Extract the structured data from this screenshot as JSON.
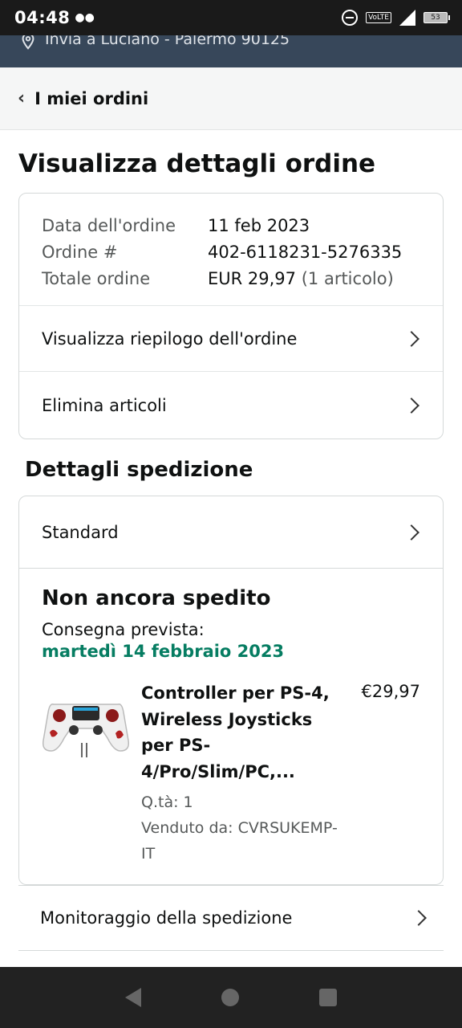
{
  "status_bar": {
    "time": "04:48",
    "battery": "53",
    "network": "VoLTE",
    "network_gen": "4G"
  },
  "deliver_to": "Invia a Luciano - Palermo 90125",
  "nav": {
    "back_label": "I miei ordini"
  },
  "page_title": "Visualizza dettagli ordine",
  "order_info": {
    "date_label": "Data dell'ordine",
    "date_value": "11 feb 2023",
    "number_label": "Ordine #",
    "number_value": "402-6118231-5276335",
    "total_label": "Totale ordine",
    "total_value": "EUR 29,97",
    "total_items": "(1 articolo)"
  },
  "order_links": {
    "summary": "Visualizza riepilogo dell'ordine",
    "delete_items": "Elimina articoli"
  },
  "shipping": {
    "section_title": "Dettagli spedizione",
    "method": "Standard",
    "status": "Non ancora spedito",
    "eta_label": "Consegna prevista:",
    "eta_date": "martedì 14 febbraio 2023",
    "eta_color": "#067d62"
  },
  "product": {
    "name": "Controller per PS-4, Wireless Joysticks per PS-4/Pro/Slim/PC,...",
    "qty": "Q.tà: 1",
    "seller": "Venduto da: CVRSUKEMP-IT",
    "price": "€29,97"
  },
  "tracking_label": "Monitoraggio della spedizione",
  "colors": {
    "header_dark": "#37475a",
    "accent_green": "#067d62",
    "border": "#d5d9d9"
  }
}
